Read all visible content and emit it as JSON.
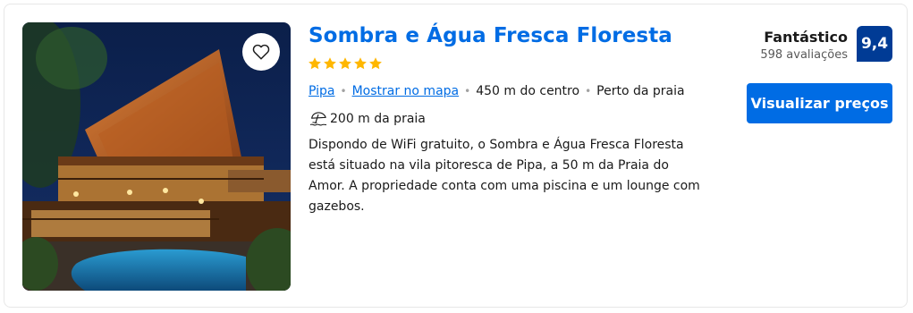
{
  "hotel": {
    "name": "Sombra e Água Fresca Floresta",
    "stars": 5,
    "location": {
      "city": "Pipa",
      "map_link": "Mostrar no mapa",
      "distance_center": "450 m do centro",
      "beach_tag": "Perto da praia"
    },
    "beach_distance": "200 m da praia",
    "description": "Dispondo de WiFi gratuito, o Sombra e Água Fresca Floresta está situado na vila pitoresca de Pipa, a 50 m da Praia do Amor. A propriedade conta com uma piscina e um lounge com gazebos."
  },
  "rating": {
    "word": "Fantástico",
    "reviews": "598 avaliações",
    "score": "9,4"
  },
  "cta": {
    "label": "Visualizar preços"
  },
  "icons": {
    "favorite": "heart-icon",
    "beach": "beach-umbrella-icon",
    "star": "star-icon"
  },
  "colors": {
    "link_blue": "#006ce4",
    "score_blue": "#003b95",
    "star_yellow": "#ffb700"
  }
}
